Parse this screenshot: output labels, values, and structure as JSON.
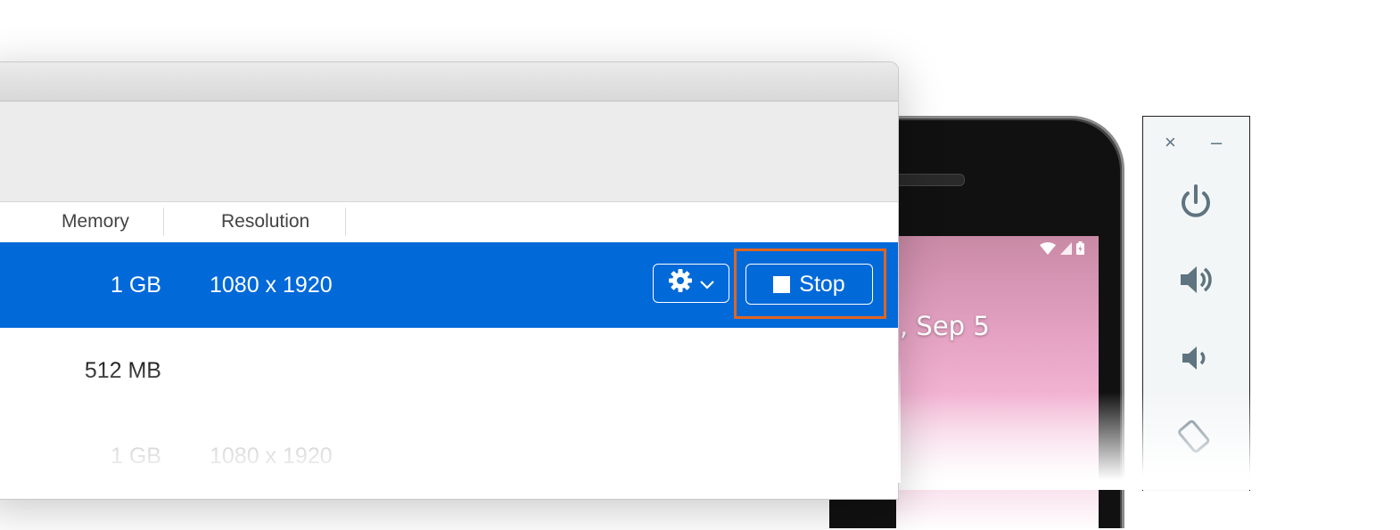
{
  "device_manager": {
    "columns": {
      "memory": "Memory",
      "resolution": "Resolution"
    },
    "rows": [
      {
        "memory": "1 GB",
        "resolution": "1080 x 1920",
        "selected": true
      },
      {
        "memory": "512 MB",
        "resolution": "",
        "selected": false
      },
      {
        "memory": "1 GB",
        "resolution": "1080 x 1920",
        "selected": false
      }
    ],
    "selected_row": {
      "settings_icon": "gear-icon",
      "dropdown_icon": "chevron-down-icon",
      "stop_label": "Stop",
      "stop_icon": "stop-square-icon"
    },
    "colors": {
      "selection": "#0269d9",
      "highlight_border": "#e0651f"
    }
  },
  "emulator": {
    "lock_screen_date": ", Sep 5",
    "status_icons": [
      "wifi-icon",
      "cell-signal-icon",
      "battery-icon"
    ],
    "toolbar": {
      "close_label": "×",
      "minimize_label": "–",
      "buttons": [
        "power-icon",
        "volume-up-icon",
        "volume-down-icon",
        "rotate-icon"
      ]
    }
  }
}
